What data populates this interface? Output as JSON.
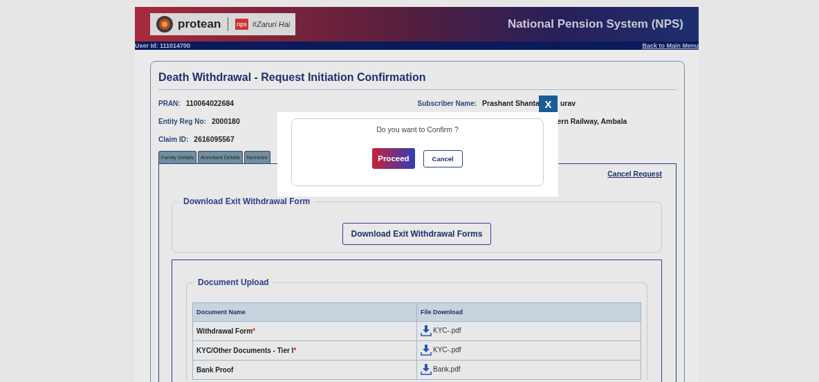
{
  "header": {
    "brand": "protean",
    "tagline": "#Zaruri Hai",
    "nps_badge": "nps",
    "title": "National Pension System (NPS)"
  },
  "user_bar": {
    "user_id": "User Id: 111014700",
    "back_link": "Back to Main Menu"
  },
  "page_title": "Death Withdrawal - Request Initiation Confirmation",
  "fields_left": [
    {
      "label": "PRAN:",
      "value": "110064022684"
    },
    {
      "label": "Entity Reg No:",
      "value": "2000180"
    },
    {
      "label": "Claim ID:",
      "value": "2616095567"
    }
  ],
  "fields_right": [
    {
      "label": "Subscriber Name:",
      "value_parts": [
        "Prashant Shanta",
        "urav"
      ]
    },
    {
      "value_parts": [
        "ern Railway, Ambala"
      ]
    }
  ],
  "tabs": [
    {
      "label": "Family Details",
      "selected": false
    },
    {
      "label": "Annuitant Details",
      "selected": false
    },
    {
      "label": "Nominee",
      "selected": false
    }
  ],
  "cancel_request": "Cancel Request",
  "download_section": {
    "legend": "Download Exit Withdrawal Form",
    "button": "Download Exit Withdrawal Forms"
  },
  "documents": {
    "legend": "Document Upload",
    "required_mark": "*",
    "columns": [
      "Document Name",
      "File Download"
    ],
    "rows": [
      {
        "name": "Withdrawal Form",
        "required": true,
        "file": "KYC-.pdf"
      },
      {
        "name": "KYC/Other Documents - Tier I",
        "required": true,
        "file": "KYC-.pdf"
      },
      {
        "name": "Bank Proof",
        "required": false,
        "file": "Bank.pdf"
      }
    ]
  },
  "dialog": {
    "close": "X",
    "message": "Do you want to Confirm ?",
    "buttons": [
      {
        "label": "Proceed",
        "kind": "primary"
      },
      {
        "label": "Cancel",
        "kind": "secondary"
      }
    ]
  }
}
